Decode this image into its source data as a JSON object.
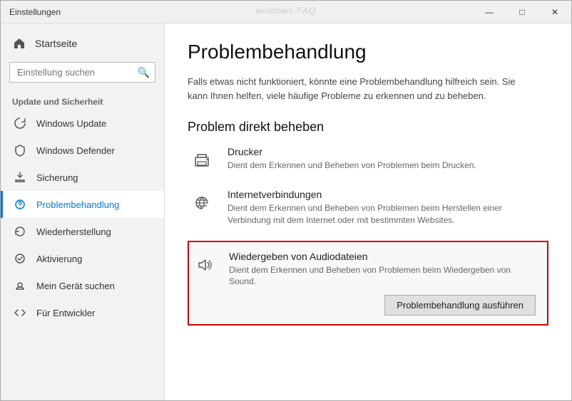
{
  "window": {
    "title": "Einstellungen",
    "watermark": "windows-FAQ",
    "controls": {
      "minimize": "—",
      "maximize": "□",
      "close": "✕"
    }
  },
  "sidebar": {
    "home_label": "Startseite",
    "search_placeholder": "Einstellung suchen",
    "section_label": "Update und Sicherheit",
    "items": [
      {
        "id": "windows-update",
        "label": "Windows Update",
        "active": false
      },
      {
        "id": "windows-defender",
        "label": "Windows Defender",
        "active": false
      },
      {
        "id": "sicherung",
        "label": "Sicherung",
        "active": false
      },
      {
        "id": "problembehandlung",
        "label": "Problembehandlung",
        "active": true
      },
      {
        "id": "wiederherstellung",
        "label": "Wiederherstellung",
        "active": false
      },
      {
        "id": "aktivierung",
        "label": "Aktivierung",
        "active": false
      },
      {
        "id": "mein-gerat",
        "label": "Mein Gerät suchen",
        "active": false
      },
      {
        "id": "fur-entwickler",
        "label": "Für Entwickler",
        "active": false
      }
    ]
  },
  "content": {
    "title": "Problembehandlung",
    "description": "Falls etwas nicht funktioniert, könnte eine Problembehandlung hilfreich sein. Sie kann Ihnen helfen, viele häufige Probleme zu erkennen und zu beheben.",
    "section_title": "Problem direkt beheben",
    "items": [
      {
        "id": "drucker",
        "title": "Drucker",
        "desc": "Dient dem Erkennen und Beheben von Problemen beim Drucken."
      },
      {
        "id": "internetverbindungen",
        "title": "Internetverbindungen",
        "desc": "Dient dem Erkennen und Beheben von Problemen beim Herstellen einer Verbindung mit dem Internet oder mit bestimmten Websites."
      }
    ],
    "highlighted_item": {
      "id": "audio",
      "title": "Wiedergeben von Audiodateien",
      "desc": "Dient dem Erkennen und Beheben von Problemen beim Wiedergeben von Sound.",
      "button_label": "Problembehandlung ausführen"
    }
  }
}
